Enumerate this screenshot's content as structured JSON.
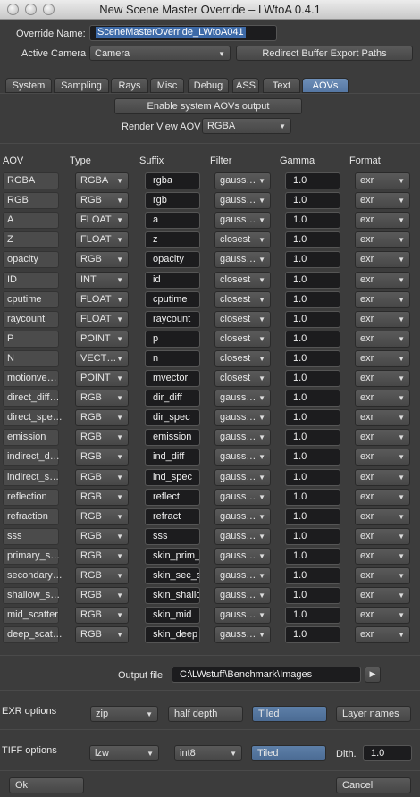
{
  "window": {
    "title": "New Scene Master Override – LWtoA 0.4.1"
  },
  "header": {
    "override_label": "Override Name:",
    "override_value": "SceneMasterOverride_LWtoA041",
    "camera_label": "Active Camera",
    "camera_value": "Camera",
    "redirect_button": "Redirect Buffer Export Paths"
  },
  "tabs": [
    "System",
    "Sampling",
    "Rays",
    "Misc",
    "Debug",
    "ASS",
    "Text",
    "AOVs"
  ],
  "active_tab": "AOVs",
  "aov_panel": {
    "enable_button": "Enable system AOVs output",
    "render_view_label": "Render View AOV",
    "render_view_value": "RGBA",
    "columns": [
      "AOV",
      "Type",
      "Suffix",
      "Filter",
      "Gamma",
      "Format"
    ]
  },
  "aovs": [
    {
      "name": "RGBA",
      "type": "RGBA",
      "suffix": "rgba",
      "filter": "gauss…",
      "gamma": "1.0",
      "format": "exr"
    },
    {
      "name": "RGB",
      "type": "RGB",
      "suffix": "rgb",
      "filter": "gauss…",
      "gamma": "1.0",
      "format": "exr"
    },
    {
      "name": "A",
      "type": "FLOAT",
      "suffix": "a",
      "filter": "gauss…",
      "gamma": "1.0",
      "format": "exr"
    },
    {
      "name": "Z",
      "type": "FLOAT",
      "suffix": "z",
      "filter": "closest",
      "gamma": "1.0",
      "format": "exr"
    },
    {
      "name": "opacity",
      "type": "RGB",
      "suffix": "opacity",
      "filter": "gauss…",
      "gamma": "1.0",
      "format": "exr"
    },
    {
      "name": "ID",
      "type": "INT",
      "suffix": "id",
      "filter": "closest",
      "gamma": "1.0",
      "format": "exr"
    },
    {
      "name": "cputime",
      "type": "FLOAT",
      "suffix": "cputime",
      "filter": "closest",
      "gamma": "1.0",
      "format": "exr"
    },
    {
      "name": "raycount",
      "type": "FLOAT",
      "suffix": "raycount",
      "filter": "closest",
      "gamma": "1.0",
      "format": "exr"
    },
    {
      "name": "P",
      "type": "POINT",
      "suffix": "p",
      "filter": "closest",
      "gamma": "1.0",
      "format": "exr"
    },
    {
      "name": "N",
      "type": "VECT…",
      "suffix": "n",
      "filter": "closest",
      "gamma": "1.0",
      "format": "exr"
    },
    {
      "name": "motionve…",
      "type": "POINT",
      "suffix": "mvector",
      "filter": "closest",
      "gamma": "1.0",
      "format": "exr"
    },
    {
      "name": "direct_diff…",
      "type": "RGB",
      "suffix": "dir_diff",
      "filter": "gauss…",
      "gamma": "1.0",
      "format": "exr"
    },
    {
      "name": "direct_spe…",
      "type": "RGB",
      "suffix": "dir_spec",
      "filter": "gauss…",
      "gamma": "1.0",
      "format": "exr"
    },
    {
      "name": "emission",
      "type": "RGB",
      "suffix": "emission",
      "filter": "gauss…",
      "gamma": "1.0",
      "format": "exr"
    },
    {
      "name": "indirect_d…",
      "type": "RGB",
      "suffix": "ind_diff",
      "filter": "gauss…",
      "gamma": "1.0",
      "format": "exr"
    },
    {
      "name": "indirect_s…",
      "type": "RGB",
      "suffix": "ind_spec",
      "filter": "gauss…",
      "gamma": "1.0",
      "format": "exr"
    },
    {
      "name": "reflection",
      "type": "RGB",
      "suffix": "reflect",
      "filter": "gauss…",
      "gamma": "1.0",
      "format": "exr"
    },
    {
      "name": "refraction",
      "type": "RGB",
      "suffix": "refract",
      "filter": "gauss…",
      "gamma": "1.0",
      "format": "exr"
    },
    {
      "name": "sss",
      "type": "RGB",
      "suffix": "sss",
      "filter": "gauss…",
      "gamma": "1.0",
      "format": "exr"
    },
    {
      "name": "primary_s…",
      "type": "RGB",
      "suffix": "skin_prim_",
      "filter": "gauss…",
      "gamma": "1.0",
      "format": "exr"
    },
    {
      "name": "secondary…",
      "type": "RGB",
      "suffix": "skin_sec_s",
      "filter": "gauss…",
      "gamma": "1.0",
      "format": "exr"
    },
    {
      "name": "shallow_s…",
      "type": "RGB",
      "suffix": "skin_shallo",
      "filter": "gauss…",
      "gamma": "1.0",
      "format": "exr"
    },
    {
      "name": "mid_scatter",
      "type": "RGB",
      "suffix": "skin_mid",
      "filter": "gauss…",
      "gamma": "1.0",
      "format": "exr"
    },
    {
      "name": "deep_scat…",
      "type": "RGB",
      "suffix": "skin_deep",
      "filter": "gauss…",
      "gamma": "1.0",
      "format": "exr"
    }
  ],
  "output": {
    "label": "Output file",
    "value": "C:\\LWstuff\\Benchmark\\Images"
  },
  "exr": {
    "label": "EXR options",
    "compression": "zip",
    "half_depth": "half depth",
    "tiled": "Tiled",
    "layer_names": "Layer names"
  },
  "tiff": {
    "label": "TIFF options",
    "compression": "lzw",
    "depth": "int8",
    "tiled": "Tiled",
    "dith_label": "Dith.",
    "dith_value": "1.0"
  },
  "footer": {
    "ok": "Ok",
    "cancel": "Cancel"
  },
  "colors": {
    "accent": "#5577a3",
    "field_bg": "#1c1c1e",
    "panel_bg": "#3c3c3c"
  }
}
